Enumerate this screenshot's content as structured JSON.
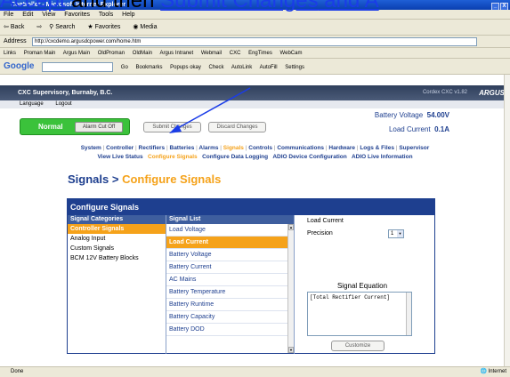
{
  "caption": {
    "pre": "Accept",
    "mid": " and then ",
    "link": "Submit Changes",
    "post": " and A"
  },
  "window": {
    "title": "Controller - Microsoft Internet Explorer",
    "min": "_",
    "close": "X"
  },
  "menu": [
    "File",
    "Edit",
    "View",
    "Favorites",
    "Tools",
    "Help"
  ],
  "toolbar": [
    "Back",
    "Forward",
    "Search",
    "Favorites",
    "Media"
  ],
  "address": {
    "label": "Address",
    "url": "http://cxcdemo.argusdcpower.com/home.htm",
    "go": "Go"
  },
  "links": {
    "label": "Links",
    "items": [
      "Proman Main",
      "Argus Main",
      "OldProman",
      "OldMain",
      "Argus Intranet",
      "Webmail",
      "CXC",
      "EngTimes",
      "WebCam"
    ]
  },
  "google": {
    "logo": "Google",
    "items": [
      "Go",
      "Bookmarks",
      "Popups okay",
      "Check",
      "AutoLink",
      "AutoFill",
      "Settings"
    ]
  },
  "site": {
    "title": "CXC Supervisory, Burnaby, B.C.",
    "version": "Cordex CXC v1.82",
    "brand": "ARGUS",
    "subnav": [
      "Language",
      "Logout"
    ]
  },
  "status": {
    "state": "Normal",
    "alarm_btn": "Alarm Cut Off",
    "submit_btn": "Submit Changes",
    "discard_btn": "Discard Changes",
    "battery_voltage_label": "Battery Voltage",
    "battery_voltage_value": "54.00V",
    "load_current_label": "Load Current",
    "load_current_value": "0.1A"
  },
  "nav": {
    "row1": [
      "System",
      "Controller",
      "Rectifiers",
      "Batteries",
      "Alarms",
      "Signals",
      "Controls",
      "Communications",
      "Hardware",
      "Logs & Files",
      "Supervisor"
    ],
    "row2": [
      "View Live Status",
      "Configure Signals",
      "Configure Data Logging",
      "ADIO Device Configuration",
      "ADIO Live Information"
    ]
  },
  "page": {
    "title_main": "Signals > ",
    "title_accent": "Configure Signals"
  },
  "panel": {
    "title": "Configure Signals",
    "categories_head": "Signal Categories",
    "categories": [
      "Controller Signals",
      "Analog Input",
      "Custom Signals",
      "BCM 12V Battery Blocks"
    ],
    "list_head": "Signal List",
    "signals": [
      "Load Voltage",
      "Load Current",
      "Battery Voltage",
      "Battery Current",
      "AC Mains",
      "Battery Temperature",
      "Battery Runtime",
      "Battery Capacity",
      "Battery DOD"
    ],
    "detail_name": "Load Current",
    "precision_label": "Precision",
    "precision_value": "1",
    "equation_label": "Signal Equation",
    "equation": "[Total Rectifier Current]",
    "customize_btn": "Customize"
  },
  "statusbar": {
    "left": "Done",
    "zone": "Internet"
  }
}
